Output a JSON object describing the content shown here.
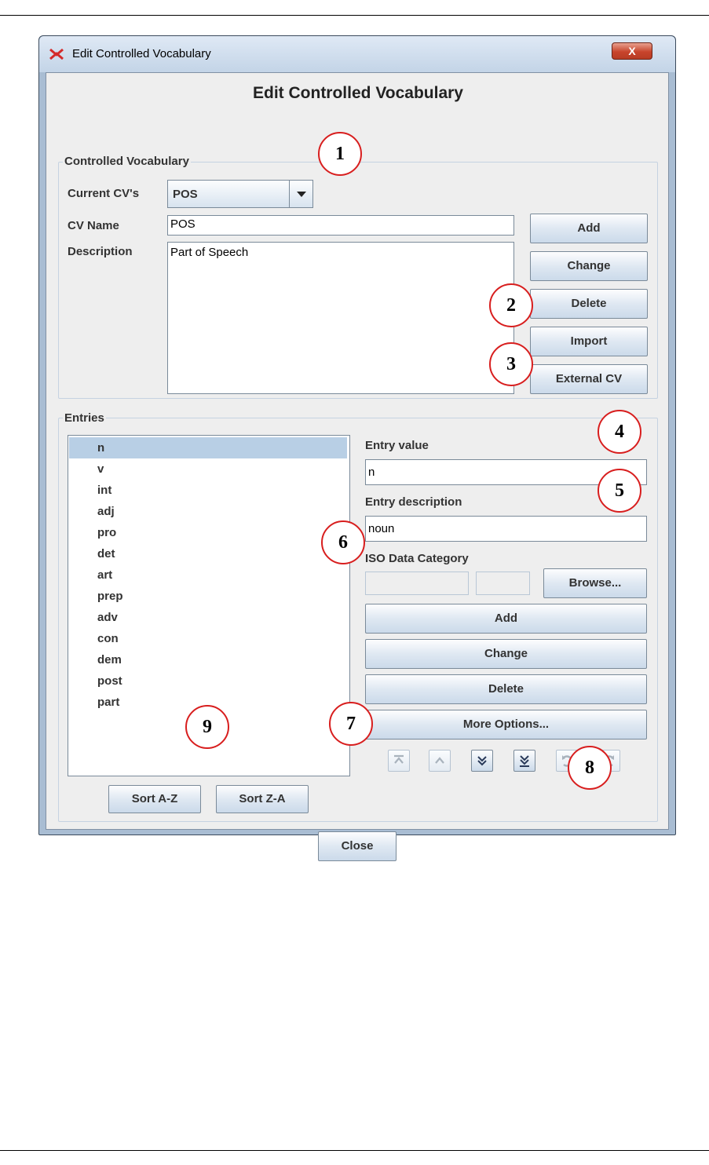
{
  "window": {
    "title": "Edit Controlled Vocabulary",
    "close_label": "X"
  },
  "heading": "Edit Controlled Vocabulary",
  "cv_section": {
    "group_label": "Controlled Vocabulary",
    "current_cvs_label": "Current CV's",
    "current_cv_value": "POS",
    "cv_name_label": "CV Name",
    "cv_name_value": "POS",
    "description_label": "Description",
    "description_value": "Part of Speech",
    "buttons": {
      "add": "Add",
      "change": "Change",
      "delete": "Delete",
      "import": "Import",
      "external_cv": "External CV"
    }
  },
  "entries_section": {
    "group_label": "Entries",
    "items": [
      "n",
      "v",
      "int",
      "adj",
      "pro",
      "det",
      "art",
      "prep",
      "adv",
      "con",
      "dem",
      "post",
      "part"
    ],
    "selected_index": 0,
    "entry_value_label": "Entry value",
    "entry_value": "n",
    "entry_description_label": "Entry description",
    "entry_description": "noun",
    "iso_label": "ISO Data Category",
    "browse_label": "Browse...",
    "buttons": {
      "add": "Add",
      "change": "Change",
      "delete": "Delete",
      "more_options": "More Options..."
    },
    "move_icons": [
      "move-to-top-icon",
      "move-up-icon",
      "move-down-icon",
      "move-to-bottom-icon",
      "undo-icon",
      "redo-icon"
    ],
    "sort_az": "Sort A-Z",
    "sort_za": "Sort Z-A"
  },
  "close_button": "Close",
  "callouts": [
    "1",
    "2",
    "3",
    "4",
    "5",
    "6",
    "7",
    "8",
    "9"
  ],
  "colors": {
    "callout_border": "#d81e1e",
    "selection": "#b8cfe5",
    "window_frame": "#a9bdd3"
  }
}
